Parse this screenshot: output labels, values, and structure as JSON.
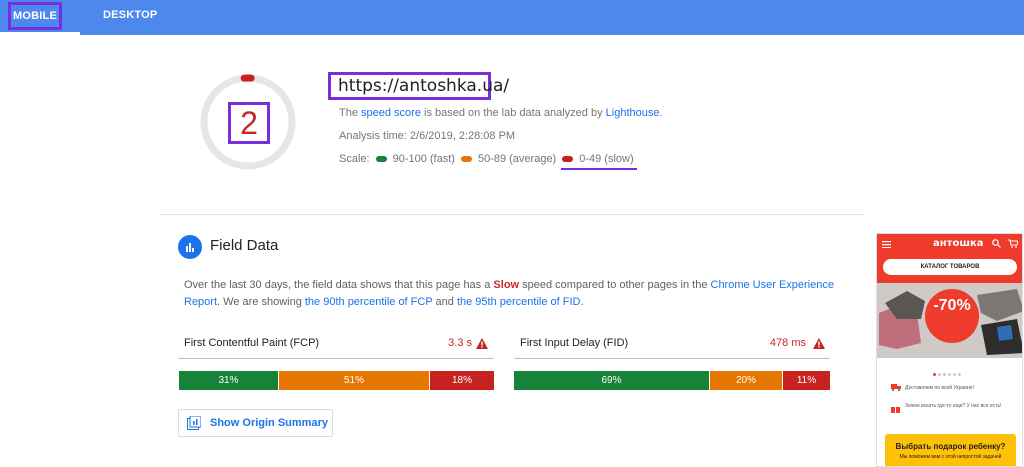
{
  "tabs": {
    "mobile": "MOBILE",
    "desktop": "DESKTOP"
  },
  "score": {
    "value": "2",
    "fill_percent": 2
  },
  "header": {
    "url": "https://antoshka.ua/",
    "desc_prefix": "The ",
    "desc_link1": "speed score",
    "desc_mid": " is based on the lab data analyzed by ",
    "desc_link2": "Lighthouse",
    "desc_suffix": ".",
    "analysis_time": "Analysis time: 2/6/2019, 2:28:08 PM",
    "scale_label": "Scale:",
    "scale_fast": "90-100 (fast)",
    "scale_average": "50-89 (average)",
    "scale_slow": "0-49 (slow)"
  },
  "colors": {
    "fast": "#178239",
    "average": "#e67700",
    "slow": "#c7221f",
    "accent": "#4c88ed"
  },
  "field_data": {
    "title": "Field Data",
    "text_1": "Over the last 30 days, the field data shows that this page has a ",
    "text_slow": "Slow",
    "text_2": " speed compared to other pages in the ",
    "text_link1": "Chrome User Experience Report",
    "text_3": ". We are showing ",
    "text_link2": "the 90th percentile of FCP",
    "text_4": " and ",
    "text_link3": "the 95th percentile of FID",
    "text_5": ".",
    "fcp": {
      "label": "First Contentful Paint (FCP)",
      "value": "3.3 s",
      "fast": "31%",
      "average": "51%",
      "slow": "18%"
    },
    "fid": {
      "label": "First Input Delay (FID)",
      "value": "478 ms",
      "fast": "69%",
      "average": "20%",
      "slow": "11%"
    },
    "origin_button": "Show Origin Summary"
  },
  "phone": {
    "logo": "антошка",
    "catalog": "КАТАЛОГ ТОВАРОВ",
    "discount": "-70%",
    "row1": "Доставляем по всей Украине!",
    "row2": "Зачем искать где-то еще? У нас все есть!",
    "gift_title": "Выбрать подарок ребенку?",
    "gift_sub": "Мы поможем вам с этой непростой задачей"
  }
}
